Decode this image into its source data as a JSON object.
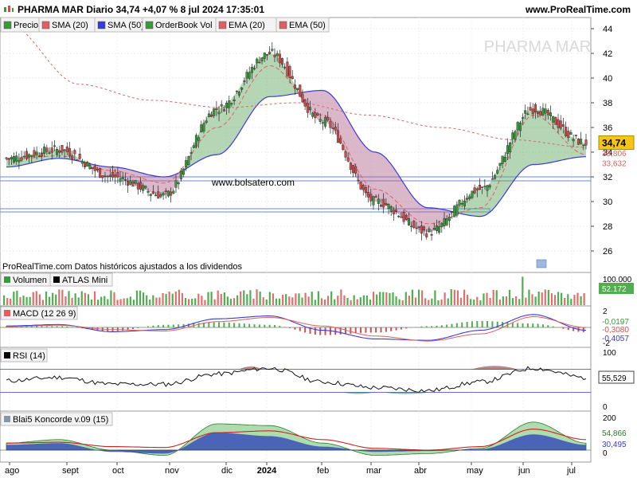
{
  "header": {
    "title": "PHARMA MAR Diario 34,74 +4,07 % 8 jul 2024 17:35:01",
    "site": "www.ProRealTime.com"
  },
  "legend": {
    "items": [
      {
        "label": "Precio",
        "color": "#3a9a3a"
      },
      {
        "label": "SMA (20)",
        "color": "#e06060"
      },
      {
        "label": "SMA (50)",
        "color": "#3a3ad8"
      },
      {
        "label": "OrderBook Vol",
        "color": "#3a9a3a"
      },
      {
        "label": "EMA (20)",
        "color": "#e06060"
      },
      {
        "label": "EMA (50)",
        "color": "#e06060"
      }
    ]
  },
  "watermark": "PHARMA MAR",
  "site_mark": "www.bolsatero.com",
  "footnote": "ProRealTime.com  Datos históricos ajustados a los dividendos",
  "colors": {
    "up": "#3a9a3a",
    "down": "#d04a4a",
    "sma20": "#e06060",
    "sma50": "#3a3ad8",
    "price_tag": "#f5c518"
  },
  "price_axis": {
    "ticks": [
      "44",
      "42",
      "40",
      "38",
      "36",
      "34",
      "32",
      "30",
      "28",
      "26"
    ],
    "last_price": "34,74",
    "tag_values": [
      "33,806",
      "33,632"
    ]
  },
  "time_axis": {
    "labels": [
      "ago",
      "sept",
      "oct",
      "nov",
      "dic",
      "2024",
      "feb",
      "mar",
      "abr",
      "may",
      "jun",
      "jul"
    ]
  },
  "volume_panel": {
    "labels": [
      "Volumen",
      "ATLAS Mini"
    ],
    "ticks": [
      "100.000"
    ],
    "value": "52.172"
  },
  "macd_panel": {
    "label": "MACD (12 26 9)",
    "ticks": [
      "2",
      "0",
      "-2"
    ],
    "values": [
      "-0,0197",
      "-0,3080",
      "-0,4057"
    ]
  },
  "rsi_panel": {
    "label": "RSI (14)",
    "ticks": [
      "100",
      "0"
    ],
    "value": "55,529"
  },
  "koncorde_panel": {
    "label": "Blai5 Koncorde v.09 (15)",
    "ticks": [
      "200",
      "0"
    ],
    "values": [
      "54,866",
      "30,495"
    ]
  },
  "chart_data": {
    "type": "line",
    "title": "PHARMA MAR Diario",
    "x": [
      "ago",
      "sept",
      "oct",
      "nov",
      "dic",
      "2024",
      "feb",
      "mar",
      "abr",
      "may",
      "jun",
      "jul"
    ],
    "series": [
      {
        "name": "Precio",
        "values": [
          33.5,
          34.2,
          32.0,
          30.5,
          37.5,
          42.0,
          36.5,
          30.0,
          27.5,
          31.0,
          37.5,
          34.74
        ]
      },
      {
        "name": "SMA (20)",
        "values": [
          33.4,
          33.7,
          32.5,
          31.5,
          36.0,
          41.0,
          37.0,
          31.0,
          28.2,
          29.5,
          37.0,
          33.806
        ]
      },
      {
        "name": "SMA (50)",
        "values": [
          32.8,
          33.5,
          32.8,
          32.0,
          33.8,
          38.5,
          39.0,
          34.0,
          29.5,
          28.8,
          33.0,
          33.632
        ]
      }
    ],
    "ylim": [
      25,
      44.5
    ],
    "grid": true,
    "legend": "top-left"
  }
}
